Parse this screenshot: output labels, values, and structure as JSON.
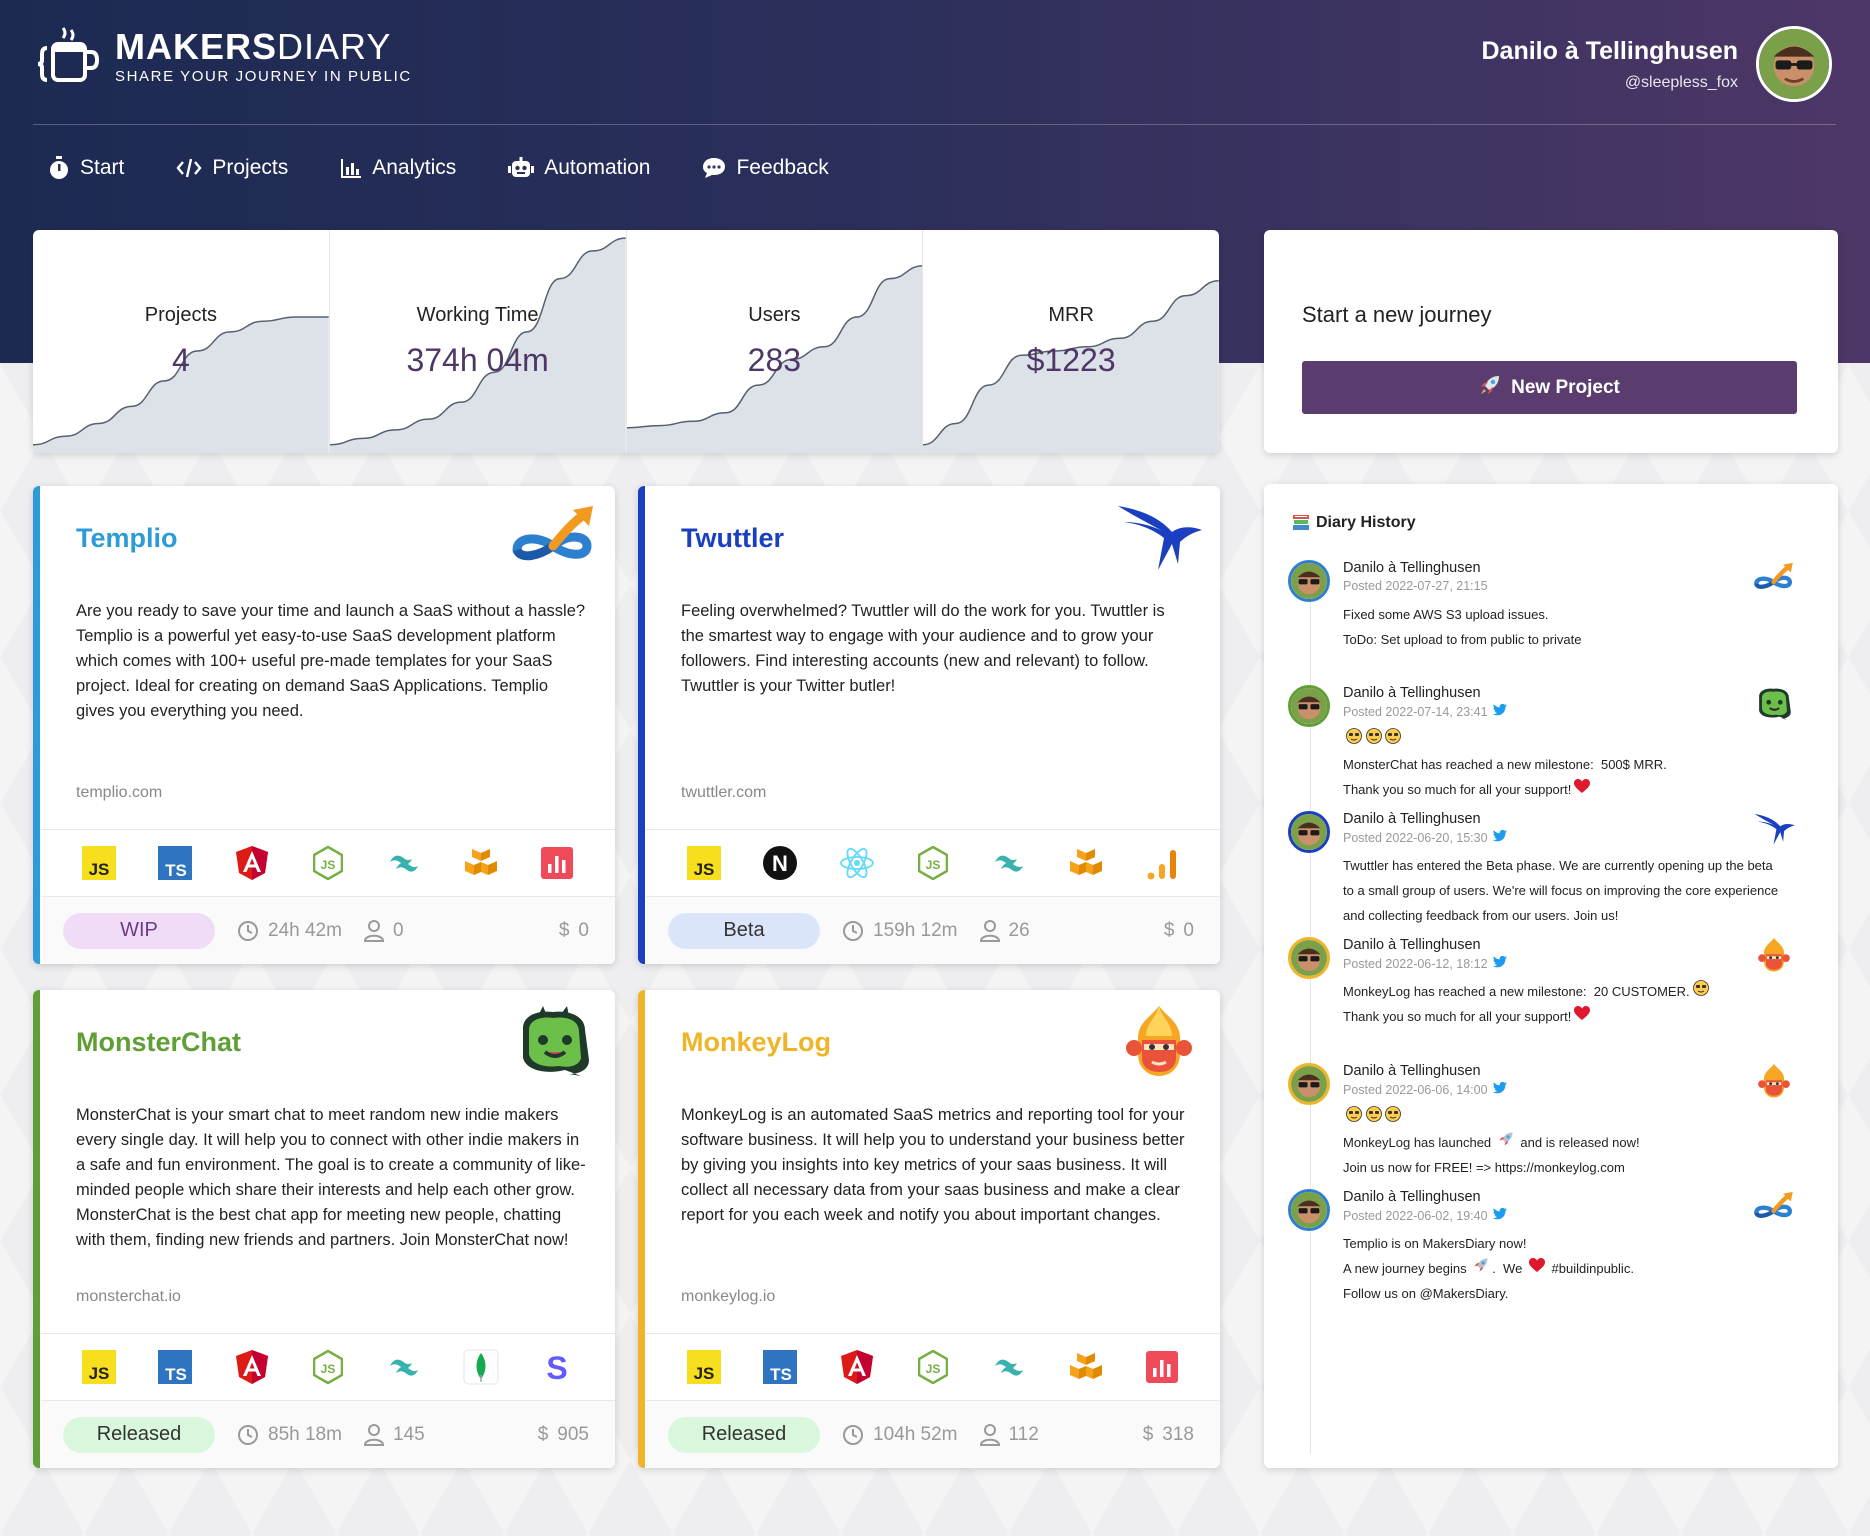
{
  "brand": {
    "name_bold": "MAKERS",
    "name_light": "DIARY",
    "tagline": "SHARE YOUR JOURNEY IN PUBLIC"
  },
  "user": {
    "name": "Danilo à Tellinghusen",
    "handle": "@sleepless_fox"
  },
  "nav": [
    {
      "label": "Start",
      "icon": "stopwatch-icon"
    },
    {
      "label": "Projects",
      "icon": "code-icon"
    },
    {
      "label": "Analytics",
      "icon": "bar-chart-icon"
    },
    {
      "label": "Automation",
      "icon": "robot-icon"
    },
    {
      "label": "Feedback",
      "icon": "chat-bubble-icon"
    }
  ],
  "stats": [
    {
      "label": "Projects",
      "value": "4",
      "trend": [
        0.02,
        0.06,
        0.12,
        0.2,
        0.32,
        0.46,
        0.55,
        0.6,
        0.62,
        0.62
      ]
    },
    {
      "label": "Working Time",
      "value": "374h 04m",
      "trend": [
        0.02,
        0.05,
        0.09,
        0.14,
        0.22,
        0.36,
        0.55,
        0.8,
        0.93,
        0.99
      ]
    },
    {
      "label": "Users",
      "value": "283",
      "trend": [
        0.1,
        0.11,
        0.13,
        0.17,
        0.3,
        0.42,
        0.48,
        0.62,
        0.8,
        0.86
      ]
    },
    {
      "label": "MRR",
      "value": "$1223",
      "trend": [
        0.02,
        0.12,
        0.3,
        0.44,
        0.46,
        0.48,
        0.52,
        0.6,
        0.72,
        0.79
      ]
    }
  ],
  "journey": {
    "title": "Start a new journey",
    "button": "New Project"
  },
  "projects": [
    {
      "name": "Templio",
      "color": "#2d9bd8",
      "logo": "infinity-arrow-logo",
      "description": "Are you ready to save your time and launch a SaaS without a hassle? Templio is a powerful yet easy-to-use SaaS development platform which comes with 100+ useful pre-made templates for your SaaS project. Ideal for creating on demand SaaS Applications. Templio gives you everything you need.",
      "url": "templio.com",
      "tech": [
        "js",
        "ts",
        "angular",
        "node",
        "tailwind",
        "aws",
        "chart"
      ],
      "status": "WIP",
      "status_bg": "#f1dcf7",
      "status_fg": "#6a3b88",
      "time": "24h 42m",
      "users": "0",
      "mrr": "0"
    },
    {
      "name": "Twuttler",
      "color": "#1a3fc0",
      "logo": "bird-logo",
      "description": "Feeling overwhelmed? Twuttler will do the work for you. Twuttler is the smartest way to engage with your audience and to grow your followers. Find interesting accounts (new and relevant) to follow. Twuttler is your Twitter butler!",
      "url": "twuttler.com",
      "tech": [
        "js",
        "next",
        "react",
        "node",
        "tailwind",
        "aws",
        "signal"
      ],
      "status": "Beta",
      "status_bg": "#dbe5fa",
      "status_fg": "#333",
      "time": "159h 12m",
      "users": "26",
      "mrr": "0"
    },
    {
      "name": "MonsterChat",
      "color": "#5f9f35",
      "logo": "monster-logo",
      "description": "MonsterChat is your smart chat to meet random new indie makers every single day. It will help you to connect with other indie makers in a safe and fun environment. The goal is to create a community of like-minded people which share their interests and help each other grow. MonsterChat is the best chat app for meeting new people, chatting with them, finding new friends and partners. Join MonsterChat now!",
      "url": "monsterchat.io",
      "tech": [
        "js",
        "ts",
        "angular",
        "node",
        "tailwind",
        "mongo",
        "stripe"
      ],
      "status": "Released",
      "status_bg": "#d9f7dc",
      "status_fg": "#333",
      "time": "85h 18m",
      "users": "145",
      "mrr": "905"
    },
    {
      "name": "MonkeyLog",
      "color": "#f0b429",
      "logo": "monkey-logo",
      "description": "MonkeyLog is an automated SaaS metrics and reporting tool for your software business. It will help you to understand your business better by giving you insights into key metrics of your saas business. It will collect all necessary data from your saas business and make a clear report for you each week and notify you about important changes.",
      "url": "monkeylog.io",
      "tech": [
        "js",
        "ts",
        "angular",
        "node",
        "tailwind",
        "aws",
        "chart"
      ],
      "status": "Released",
      "status_bg": "#d9f7dc",
      "status_fg": "#333",
      "time": "104h 52m",
      "users": "112",
      "mrr": "318"
    }
  ],
  "history": {
    "title": "Diary History",
    "entries": [
      {
        "name": "Danilo à Tellinghusen",
        "posted": "Posted 2022-07-27, 21:15",
        "twitter": false,
        "ring": "#2f7fd0",
        "logo": "infinity-arrow-logo",
        "lines": [
          [
            "Fixed some AWS S3 upload issues."
          ],
          [
            "ToDo: Set upload to from public to private"
          ]
        ]
      },
      {
        "name": "Danilo à Tellinghusen",
        "posted": "Posted 2022-07-14, 23:41",
        "twitter": true,
        "ring": "#5f9f35",
        "logo": "monster-logo",
        "lines": [
          [
            "@emoji3"
          ],
          [
            "MonsterChat has reached a new milestone:  500$ MRR."
          ],
          [
            "Thank you so much for all your support!",
            "@heart"
          ]
        ]
      },
      {
        "name": "Danilo à Tellinghusen",
        "posted": "Posted 2022-06-20, 15:30",
        "twitter": true,
        "ring": "#1a3fc0",
        "logo": "bird-logo",
        "lines": [
          [
            "Twuttler has entered the Beta phase. We are currently opening up the beta"
          ],
          [
            "to a small group of users. We're will focus on improving the core experience"
          ],
          [
            "and collecting feedback from our users. Join us!"
          ]
        ]
      },
      {
        "name": "Danilo à Tellinghusen",
        "posted": "Posted 2022-06-12, 18:12",
        "twitter": true,
        "ring": "#f0b429",
        "logo": "monkey-logo",
        "lines": [
          [
            "MonkeyLog has reached a new milestone:  20 CUSTOMER.",
            "@emoji1"
          ],
          [
            "Thank you so much for all your support!",
            "@heart"
          ]
        ]
      },
      {
        "name": "Danilo à Tellinghusen",
        "posted": "Posted 2022-06-06, 14:00",
        "twitter": true,
        "ring": "#f0b429",
        "logo": "monkey-logo",
        "lines": [
          [
            "@emoji3"
          ],
          [
            "MonkeyLog has launched ",
            "@rocket",
            " and is released now!"
          ],
          [
            "Join us now for FREE! => https://monkeylog.com"
          ]
        ]
      },
      {
        "name": "Danilo à Tellinghusen",
        "posted": "Posted 2022-06-02, 19:40",
        "twitter": true,
        "ring": "#2f7fd0",
        "logo": "infinity-arrow-logo",
        "lines": [
          [
            "Templio is on MakersDiary now!"
          ],
          [
            "A new journey begins ",
            "@rocket",
            ".  We ",
            "@heart",
            " #buildinpublic."
          ],
          [
            "Follow us on @MakersDiary."
          ]
        ]
      }
    ]
  }
}
